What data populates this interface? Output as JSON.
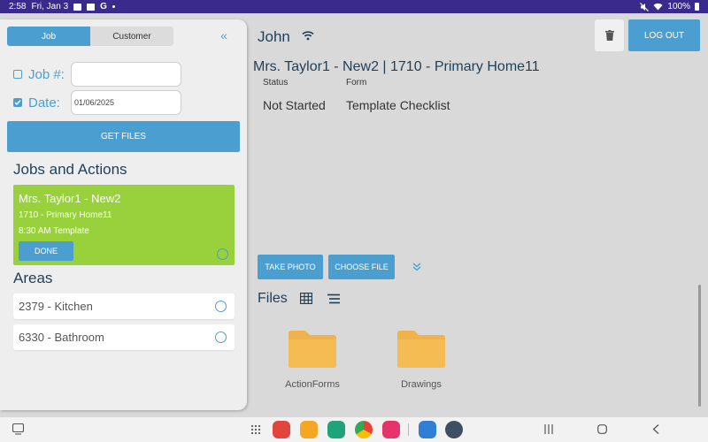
{
  "status_bar": {
    "time": "2:58",
    "date": "Fri, Jan 3",
    "battery": "100%"
  },
  "left_panel": {
    "tabs": [
      {
        "label": "Job",
        "active": true
      },
      {
        "label": "Customer",
        "active": false
      }
    ],
    "job_number": {
      "label": "Job #:",
      "value": ""
    },
    "date": {
      "label": "Date:",
      "value": "01/06/2025"
    },
    "get_files_label": "GET FILES",
    "jobs_heading": "Jobs and Actions",
    "job_card": {
      "title": "Mrs. Taylor1 - New2",
      "line2": "1710 - Primary Home11",
      "line3": "8:30 AM Template",
      "done_label": "DONE"
    },
    "areas_heading": "Areas",
    "areas": [
      {
        "label": "2379 - Kitchen"
      },
      {
        "label": "6330 - Bathroom"
      }
    ]
  },
  "header": {
    "user_name": "John",
    "logout_label": "LOG OUT"
  },
  "main": {
    "job_title": "Mrs. Taylor1 - New2 | 1710 - Primary Home11",
    "columns": [
      {
        "head": "Status",
        "value": "Not Started"
      },
      {
        "head": "Form",
        "value": "Template Checklist"
      }
    ],
    "take_photo_label": "TAKE PHOTO",
    "choose_file_label": "CHOOSE FILE",
    "files_heading": "Files",
    "folders": [
      {
        "label": "ActionForms"
      },
      {
        "label": "Drawings"
      }
    ]
  },
  "colors": {
    "accent": "#4a9fd0",
    "job_card": "#99d13c",
    "folder": "#f0b24c",
    "status_bar": "#3a2a8c"
  }
}
